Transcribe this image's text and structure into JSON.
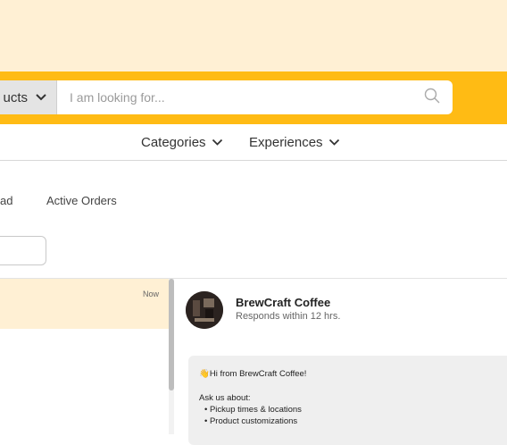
{
  "header": {
    "scope_label": "ucts",
    "search_placeholder": "I am looking for..."
  },
  "nav": {
    "categories": "Categories",
    "experiences": "Experiences"
  },
  "tabs": [
    {
      "label": "ad"
    },
    {
      "label": "Active Orders"
    }
  ],
  "conversation_list": {
    "items": [
      {
        "time": "Now"
      }
    ]
  },
  "chat": {
    "name": "BrewCraft Coffee",
    "status": "Responds within 12 hrs.",
    "message": {
      "greeting_emoji": "👋",
      "greeting": "Hi from BrewCraft Coffee!",
      "ask_intro": "Ask us about:",
      "bullets": [
        "Pickup times & locations",
        "Product customizations"
      ]
    }
  },
  "colors": {
    "banner": "#fff0d4",
    "search_bar": "#ffbb14",
    "active_convo": "#fff0d4"
  }
}
